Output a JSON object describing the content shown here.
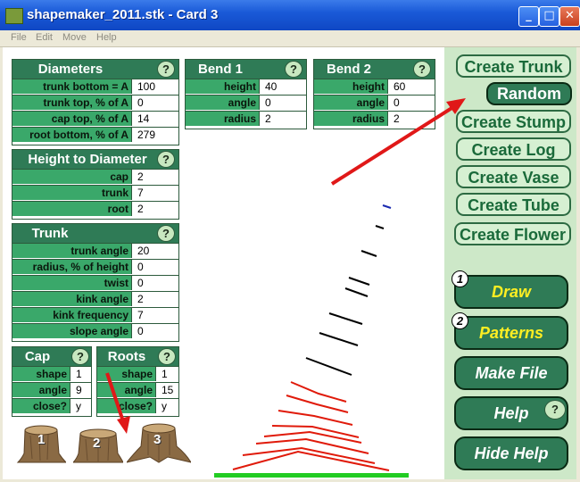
{
  "window": {
    "title": "shapemaker_2011.stk - Card 3",
    "minimize_glyph": "_",
    "maximize_glyph": "□",
    "close_glyph": "✕"
  },
  "menu": [
    "File",
    "Edit",
    "Move",
    "Help"
  ],
  "help_glyph": "?",
  "diameters": {
    "title": "Diameters",
    "rows": [
      {
        "label": "trunk bottom = A",
        "value": "100"
      },
      {
        "label": "trunk top, % of A",
        "value": "0"
      },
      {
        "label": "cap top, % of A",
        "value": "14"
      },
      {
        "label": "root bottom, % of A",
        "value": "279"
      }
    ]
  },
  "bend1": {
    "title": "Bend 1",
    "rows": [
      {
        "label": "height",
        "value": "40"
      },
      {
        "label": "angle",
        "value": "0"
      },
      {
        "label": "radius",
        "value": "2"
      }
    ]
  },
  "bend2": {
    "title": "Bend 2",
    "rows": [
      {
        "label": "height",
        "value": "60"
      },
      {
        "label": "angle",
        "value": "0"
      },
      {
        "label": "radius",
        "value": "2"
      }
    ]
  },
  "height_to_diameter": {
    "title": "Height to Diameter",
    "rows": [
      {
        "label": "cap",
        "value": "2"
      },
      {
        "label": "trunk",
        "value": "7"
      },
      {
        "label": "root",
        "value": "2"
      }
    ]
  },
  "trunk": {
    "title": "Trunk",
    "rows": [
      {
        "label": "trunk angle",
        "value": "20"
      },
      {
        "label": "radius, % of height",
        "value": "0"
      },
      {
        "label": "twist",
        "value": "0"
      },
      {
        "label": "kink angle",
        "value": "2"
      },
      {
        "label": "kink frequency",
        "value": "7"
      },
      {
        "label": "slope angle",
        "value": "0"
      }
    ]
  },
  "cap": {
    "title": "Cap",
    "rows": [
      {
        "label": "shape",
        "value": "1"
      },
      {
        "label": "angle",
        "value": "9"
      },
      {
        "label": "close?",
        "value": "y"
      }
    ]
  },
  "roots": {
    "title": "Roots",
    "rows": [
      {
        "label": "shape",
        "value": "1"
      },
      {
        "label": "angle",
        "value": "15"
      },
      {
        "label": "close?",
        "value": "y"
      }
    ]
  },
  "stumps": [
    "1",
    "2",
    "3"
  ],
  "buttons": {
    "create_trunk": "Create Trunk",
    "random": "Random",
    "create_stump": "Create Stump",
    "create_log": "Create Log",
    "create_vase": "Create Vase",
    "create_tube": "Create Tube",
    "create_flower": "Create Flower",
    "draw": "Draw",
    "draw_badge": "1",
    "patterns": "Patterns",
    "patterns_badge": "2",
    "make_file": "Make File",
    "help": "Help",
    "hide_help": "Hide Help"
  },
  "colors": {
    "title_bar": "#1a5ad8",
    "panel_header": "#2f7b56",
    "label_cell": "#3aa86a",
    "right_panel": "#cde8c8",
    "preview_red": "#e01a0a",
    "preview_black": "#000000",
    "preview_blue": "#1a2ab0",
    "ground_green": "#22cc22",
    "annotation_arrow": "#e01818"
  }
}
